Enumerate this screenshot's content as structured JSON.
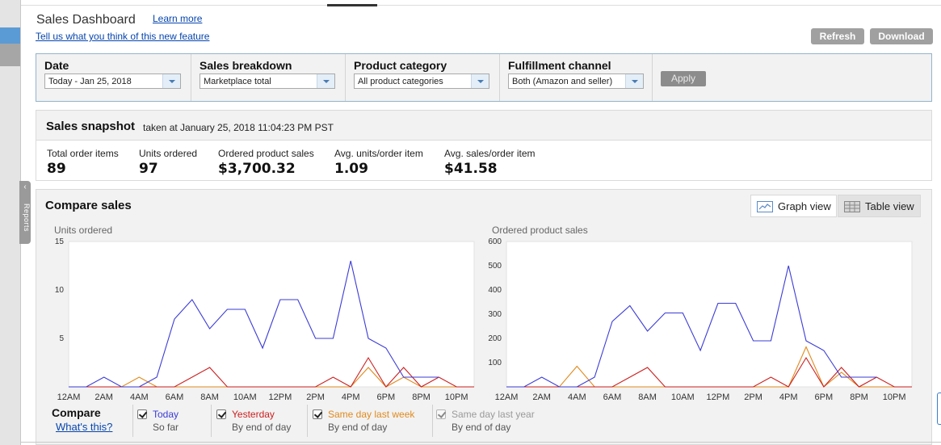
{
  "header": {
    "title": "Sales Dashboard",
    "learn_more": "Learn more",
    "feedback": "Tell us what you think of this new feature",
    "refresh": "Refresh",
    "download": "Download"
  },
  "sidebar": {
    "reports_label": "Reports"
  },
  "filters": [
    {
      "label": "Date",
      "value": "Today - Jan 25, 2018"
    },
    {
      "label": "Sales breakdown",
      "value": "Marketplace total"
    },
    {
      "label": "Product category",
      "value": "All product categories"
    },
    {
      "label": "Fulfillment channel",
      "value": "Both (Amazon and seller)"
    }
  ],
  "apply": "Apply",
  "snapshot": {
    "title": "Sales snapshot",
    "taken_at": "taken at January 25, 2018 11:04:23 PM PST",
    "metrics": [
      {
        "label": "Total order items",
        "value": "89"
      },
      {
        "label": "Units ordered",
        "value": "97"
      },
      {
        "label": "Ordered product sales",
        "value": "$3,700.32"
      },
      {
        "label": "Avg. units/order item",
        "value": "1.09"
      },
      {
        "label": "Avg. sales/order item",
        "value": "$41.58"
      }
    ]
  },
  "compare": {
    "title": "Compare sales",
    "graph_view": "Graph view",
    "table_view": "Table view",
    "compare_label": "Compare",
    "whats_this": "What's this?",
    "series": [
      {
        "name": "Today",
        "sub": "So far",
        "color": "#3b3bd6",
        "checked": true
      },
      {
        "name": "Yesterday",
        "sub": "By end of day",
        "color": "#cc1f1f",
        "checked": true
      },
      {
        "name": "Same day last week",
        "sub": "By end of day",
        "color": "#e08a1e",
        "checked": true
      },
      {
        "name": "Same day last year",
        "sub": "By end of day",
        "color": "#9a9a9a",
        "checked": true
      }
    ]
  },
  "colors": {
    "today": "#3b3bd6",
    "yesterday": "#cc1f1f",
    "last_week": "#e08a1e",
    "last_year": "#9a9a9a"
  },
  "chart_data": [
    {
      "type": "line",
      "title": "Units ordered",
      "ylim": [
        0,
        15
      ],
      "yticks": [
        "5",
        "10",
        "15"
      ],
      "xtick_labels": [
        "12AM",
        "2AM",
        "4AM",
        "6AM",
        "8AM",
        "10AM",
        "12PM",
        "2PM",
        "4PM",
        "6PM",
        "8PM",
        "10PM"
      ],
      "x_hours": [
        0,
        1,
        2,
        3,
        4,
        5,
        6,
        7,
        8,
        9,
        10,
        11,
        12,
        13,
        14,
        15,
        16,
        17,
        18,
        19,
        20,
        21,
        22,
        23
      ],
      "series": [
        {
          "name": "Today",
          "values": [
            0,
            0,
            1,
            0,
            0,
            1,
            7,
            9,
            6,
            8,
            8,
            4,
            9,
            9,
            5,
            5,
            13,
            5,
            4,
            1,
            1,
            1,
            null,
            null
          ]
        },
        {
          "name": "Yesterday",
          "values": [
            0,
            0,
            0,
            0,
            0,
            0,
            0,
            1,
            2,
            0,
            0,
            0,
            0,
            0,
            0,
            1,
            0,
            3,
            0,
            2,
            0,
            1,
            0,
            0
          ]
        },
        {
          "name": "Same day last week",
          "values": [
            0,
            0,
            0,
            0,
            1,
            0,
            0,
            0,
            0,
            0,
            0,
            0,
            0,
            0,
            0,
            0,
            0,
            2,
            0,
            1,
            0,
            0,
            0,
            0
          ]
        }
      ]
    },
    {
      "type": "line",
      "title": "Ordered product sales",
      "ylim": [
        0,
        600
      ],
      "yticks": [
        "100",
        "200",
        "300",
        "400",
        "500",
        "600"
      ],
      "xtick_labels": [
        "12AM",
        "2AM",
        "4AM",
        "6AM",
        "8AM",
        "10AM",
        "12PM",
        "2PM",
        "4PM",
        "6PM",
        "8PM",
        "10PM"
      ],
      "x_hours": [
        0,
        1,
        2,
        3,
        4,
        5,
        6,
        7,
        8,
        9,
        10,
        11,
        12,
        13,
        14,
        15,
        16,
        17,
        18,
        19,
        20,
        21,
        22,
        23
      ],
      "series": [
        {
          "name": "Today",
          "values": [
            0,
            0,
            40,
            0,
            0,
            40,
            270,
            335,
            230,
            305,
            305,
            150,
            345,
            345,
            190,
            190,
            500,
            190,
            150,
            40,
            40,
            40,
            null,
            null
          ]
        },
        {
          "name": "Yesterday",
          "values": [
            0,
            0,
            0,
            0,
            0,
            0,
            0,
            40,
            80,
            0,
            0,
            0,
            0,
            0,
            0,
            40,
            0,
            120,
            0,
            80,
            0,
            40,
            0,
            0
          ]
        },
        {
          "name": "Same day last week",
          "values": [
            0,
            0,
            0,
            0,
            85,
            0,
            0,
            0,
            0,
            0,
            0,
            0,
            0,
            0,
            0,
            0,
            0,
            165,
            0,
            60,
            0,
            0,
            0,
            0
          ]
        }
      ]
    }
  ]
}
